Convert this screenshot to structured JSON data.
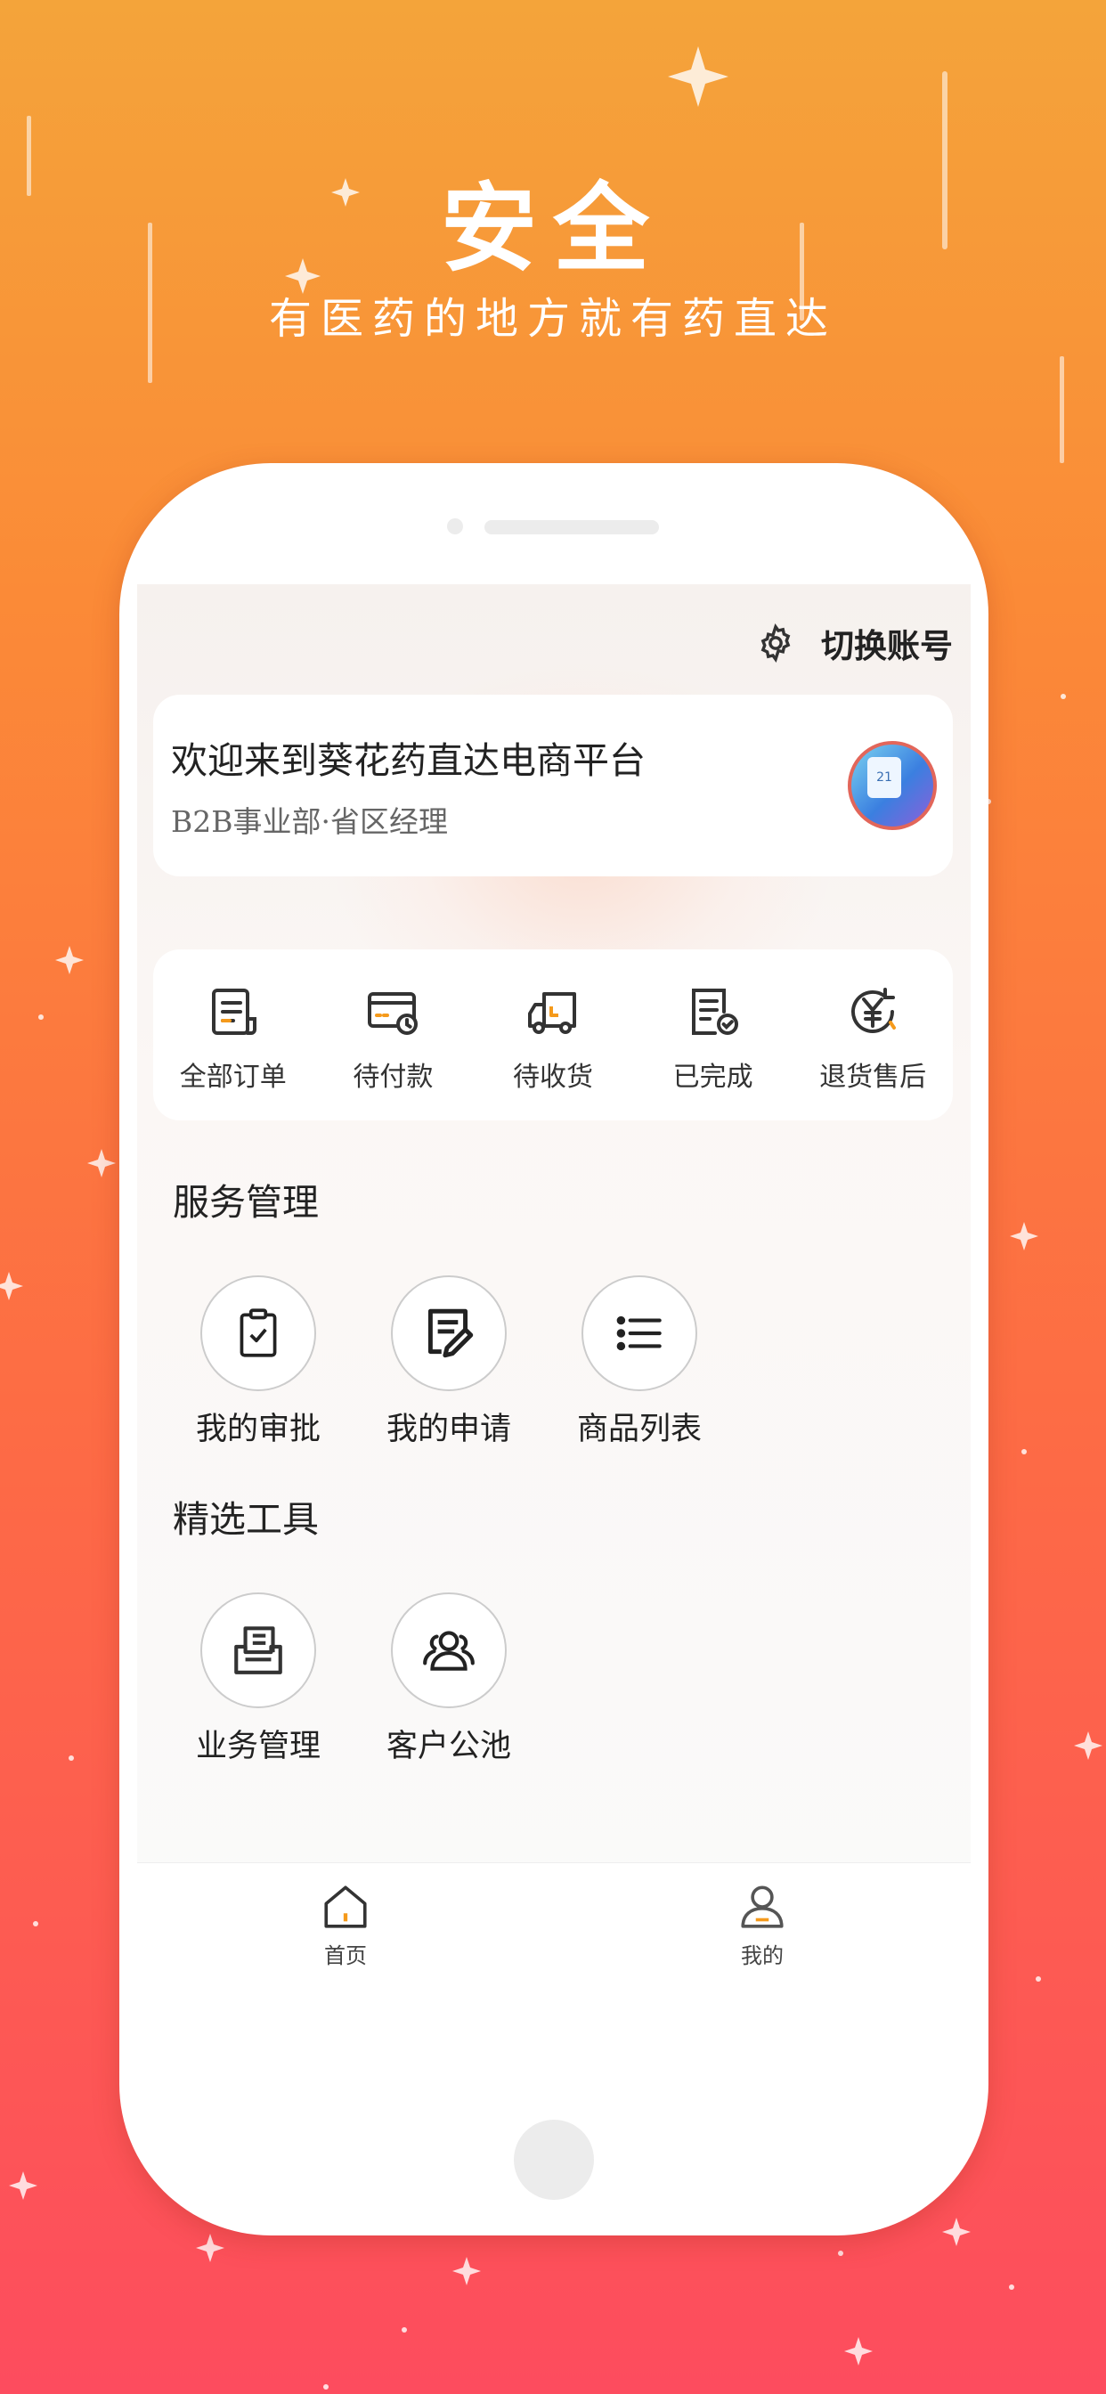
{
  "hero": {
    "title": "安全",
    "subtitle": "有医药的地方就有药直达"
  },
  "header": {
    "switch_account": "切换账号",
    "settings_icon": "gear-icon"
  },
  "welcome": {
    "title": "欢迎来到葵花药直达电商平台",
    "subtitle": "B2B事业部·省区经理",
    "avatar_date": "21"
  },
  "orders": [
    {
      "label": "全部订单",
      "icon": "order-list-icon"
    },
    {
      "label": "待付款",
      "icon": "card-clock-icon"
    },
    {
      "label": "待收货",
      "icon": "truck-icon"
    },
    {
      "label": "已完成",
      "icon": "document-check-icon"
    },
    {
      "label": "退货售后",
      "icon": "yen-return-icon"
    }
  ],
  "services": {
    "title": "服务管理",
    "items": [
      {
        "label": "我的审批",
        "icon": "clipboard-check-icon"
      },
      {
        "label": "我的申请",
        "icon": "edit-document-icon"
      },
      {
        "label": "商品列表",
        "icon": "list-icon"
      }
    ]
  },
  "tools": {
    "title": "精选工具",
    "items": [
      {
        "label": "业务管理",
        "icon": "inbox-document-icon"
      },
      {
        "label": "客户公池",
        "icon": "users-icon"
      }
    ]
  },
  "tabbar": [
    {
      "label": "首页",
      "icon": "home-icon",
      "active": true
    },
    {
      "label": "我的",
      "icon": "user-icon",
      "active": false
    }
  ],
  "colors": {
    "accent": "#fd7a3c",
    "icon_orange": "#f59a1b",
    "bg_top": "#f4a43a",
    "bg_bottom": "#fd4c5e"
  }
}
